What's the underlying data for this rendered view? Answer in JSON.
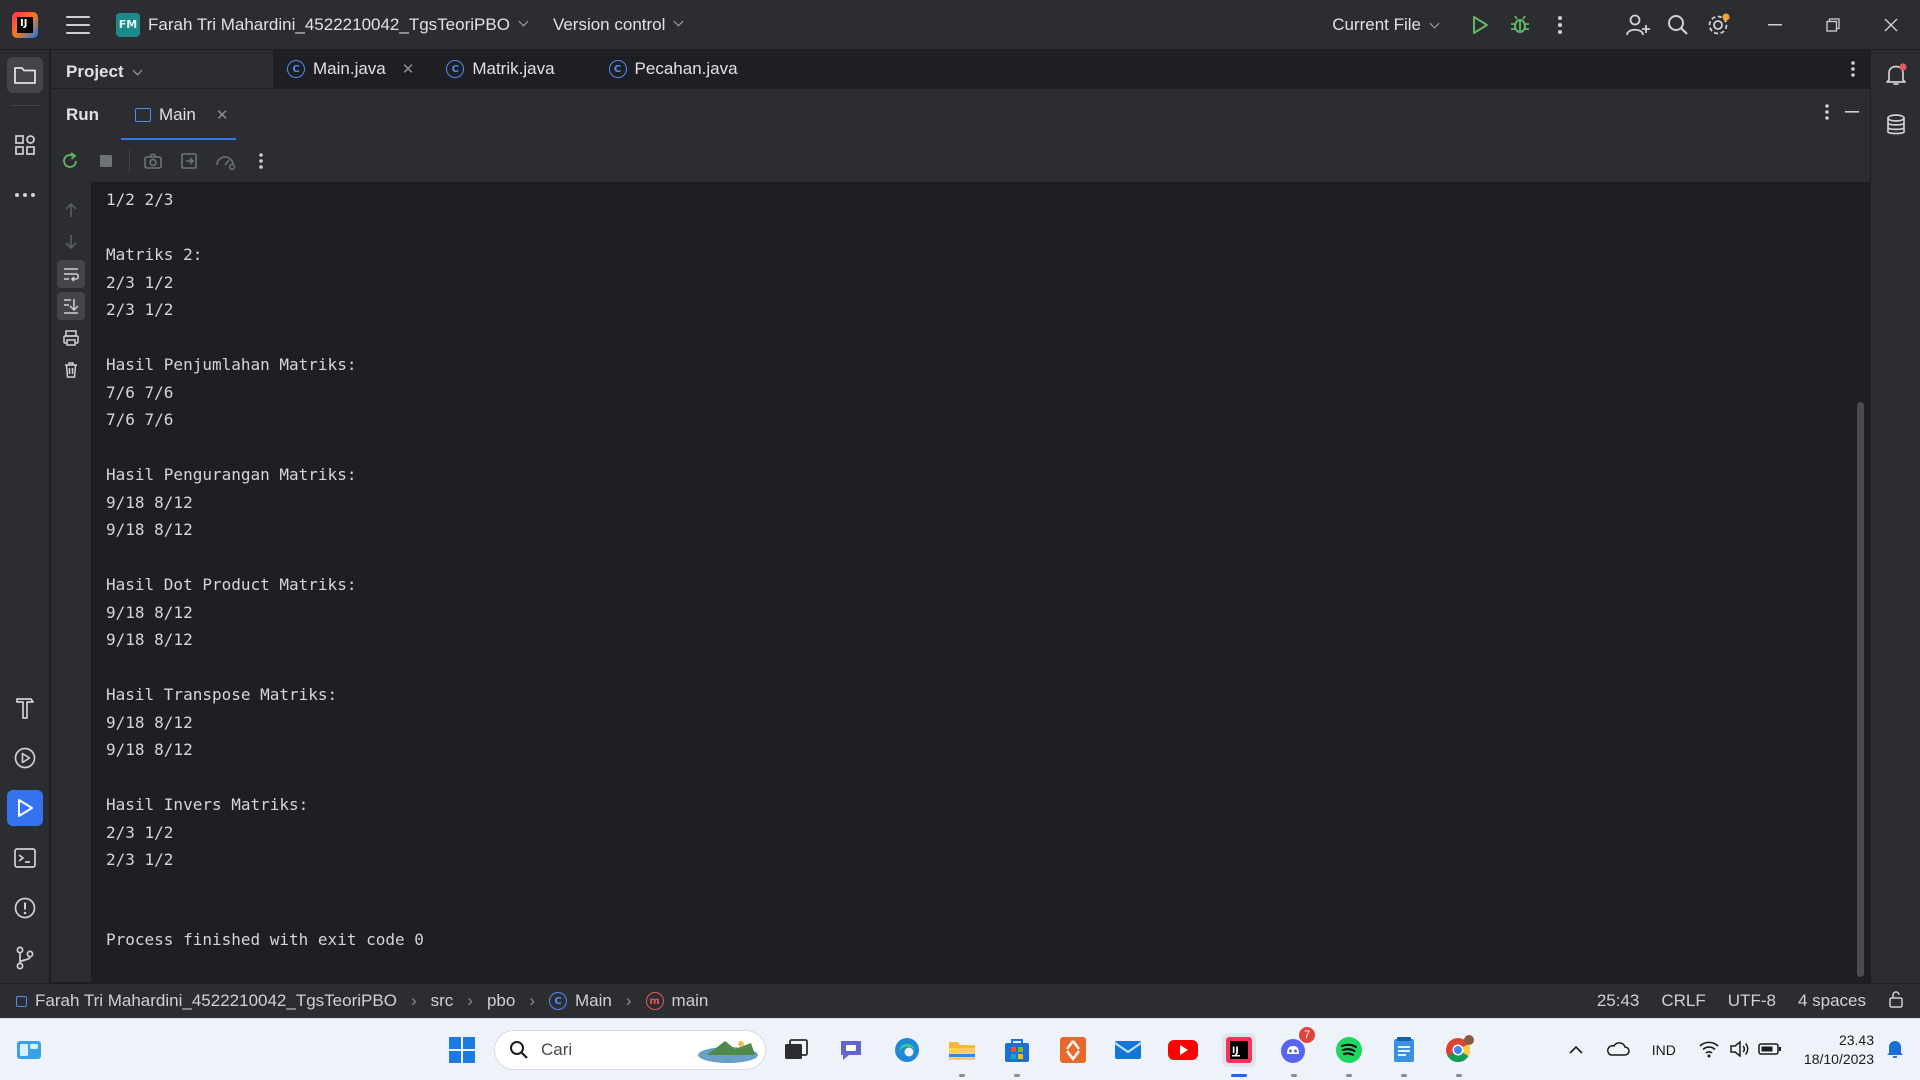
{
  "window": {
    "project_badge": "FM",
    "project_name": "Farah Tri Mahardini_4522210042_TgsTeoriPBO",
    "vcs_label": "Version control",
    "run_config": "Current File"
  },
  "panel": {
    "project_title": "Project"
  },
  "editor_tabs": [
    {
      "label": "Main.java",
      "icon": "class-icon",
      "closable": true
    },
    {
      "label": "Matrik.java",
      "icon": "class-icon"
    },
    {
      "label": "Pecahan.java",
      "icon": "class-icon"
    }
  ],
  "run": {
    "title": "Run",
    "tab_label": "Main"
  },
  "console": {
    "lines": "1/2 2/3\n\nMatriks 2:\n2/3 1/2\n2/3 1/2\n\nHasil Penjumlahan Matriks:\n7/6 7/6\n7/6 7/6\n\nHasil Pengurangan Matriks:\n9/18 8/12\n9/18 8/12\n\nHasil Dot Product Matriks:\n9/18 8/12\n9/18 8/12\n\nHasil Transpose Matriks:\n9/18 8/12\n9/18 8/12\n\nHasil Invers Matriks:\n2/3 1/2\n2/3 1/2",
    "exit_line": "Process finished with exit code 0"
  },
  "statusbar": {
    "crumbs": [
      "Farah Tri Mahardini_4522210042_TgsTeoriPBO",
      "src",
      "pbo",
      "Main",
      "main"
    ],
    "position": "25:43",
    "line_sep": "CRLF",
    "encoding": "UTF-8",
    "indent": "4 spaces"
  },
  "taskbar": {
    "search_placeholder": "Cari",
    "lang": "IND",
    "time": "23.43",
    "date": "18/10/2023",
    "discord_badge": "7"
  },
  "colors": {
    "accent": "#3574f0",
    "bg": "#1e1f22",
    "panel": "#2b2d30"
  }
}
